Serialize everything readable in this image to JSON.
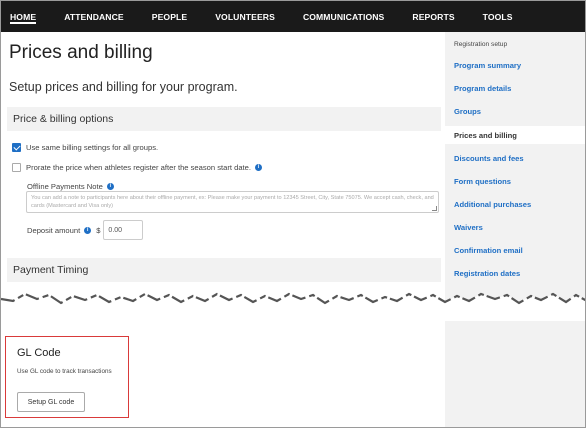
{
  "nav": {
    "items": [
      "HOME",
      "ATTENDANCE",
      "PEOPLE",
      "VOLUNTEERS",
      "COMMUNICATIONS",
      "REPORTS",
      "TOOLS"
    ],
    "active": "HOME"
  },
  "page": {
    "title": "Prices and billing",
    "subtitle": "Setup prices and billing for your program."
  },
  "options": {
    "header": "Price & billing options",
    "same_billing": {
      "label": "Use same billing settings for all groups.",
      "checked": true
    },
    "prorate": {
      "label": "Prorate the price when athletes register after the season start date.",
      "checked": false
    },
    "offline_note": {
      "label": "Offline Payments Note",
      "placeholder": "You can add a note to participants here about their offline payment, ex: Please make your payment to 12345 Street, City, State 75075. We accept cash, check, and cards (Mastercard and Visa only)"
    },
    "deposit": {
      "label": "Deposit amount",
      "currency": "$",
      "value": "0.00"
    }
  },
  "payment_timing": {
    "header": "Payment Timing"
  },
  "sidebar": {
    "heading": "Registration setup",
    "items": [
      {
        "label": "Program summary"
      },
      {
        "label": "Program details"
      },
      {
        "label": "Groups"
      },
      {
        "label": "Prices and billing"
      },
      {
        "label": "Discounts and fees"
      },
      {
        "label": "Form questions"
      },
      {
        "label": "Additional purchases"
      },
      {
        "label": "Waivers"
      },
      {
        "label": "Confirmation email"
      },
      {
        "label": "Registration dates"
      }
    ],
    "active": "Prices and billing"
  },
  "gl_code": {
    "title": "GL Code",
    "description": "Use GL code to track transactions",
    "button": "Setup GL code"
  },
  "colors": {
    "nav_bg": "#1a1a1a",
    "link": "#1f6fc5",
    "highlight_border": "#d93a3a",
    "sidebar_bg": "#f2f2f2"
  }
}
